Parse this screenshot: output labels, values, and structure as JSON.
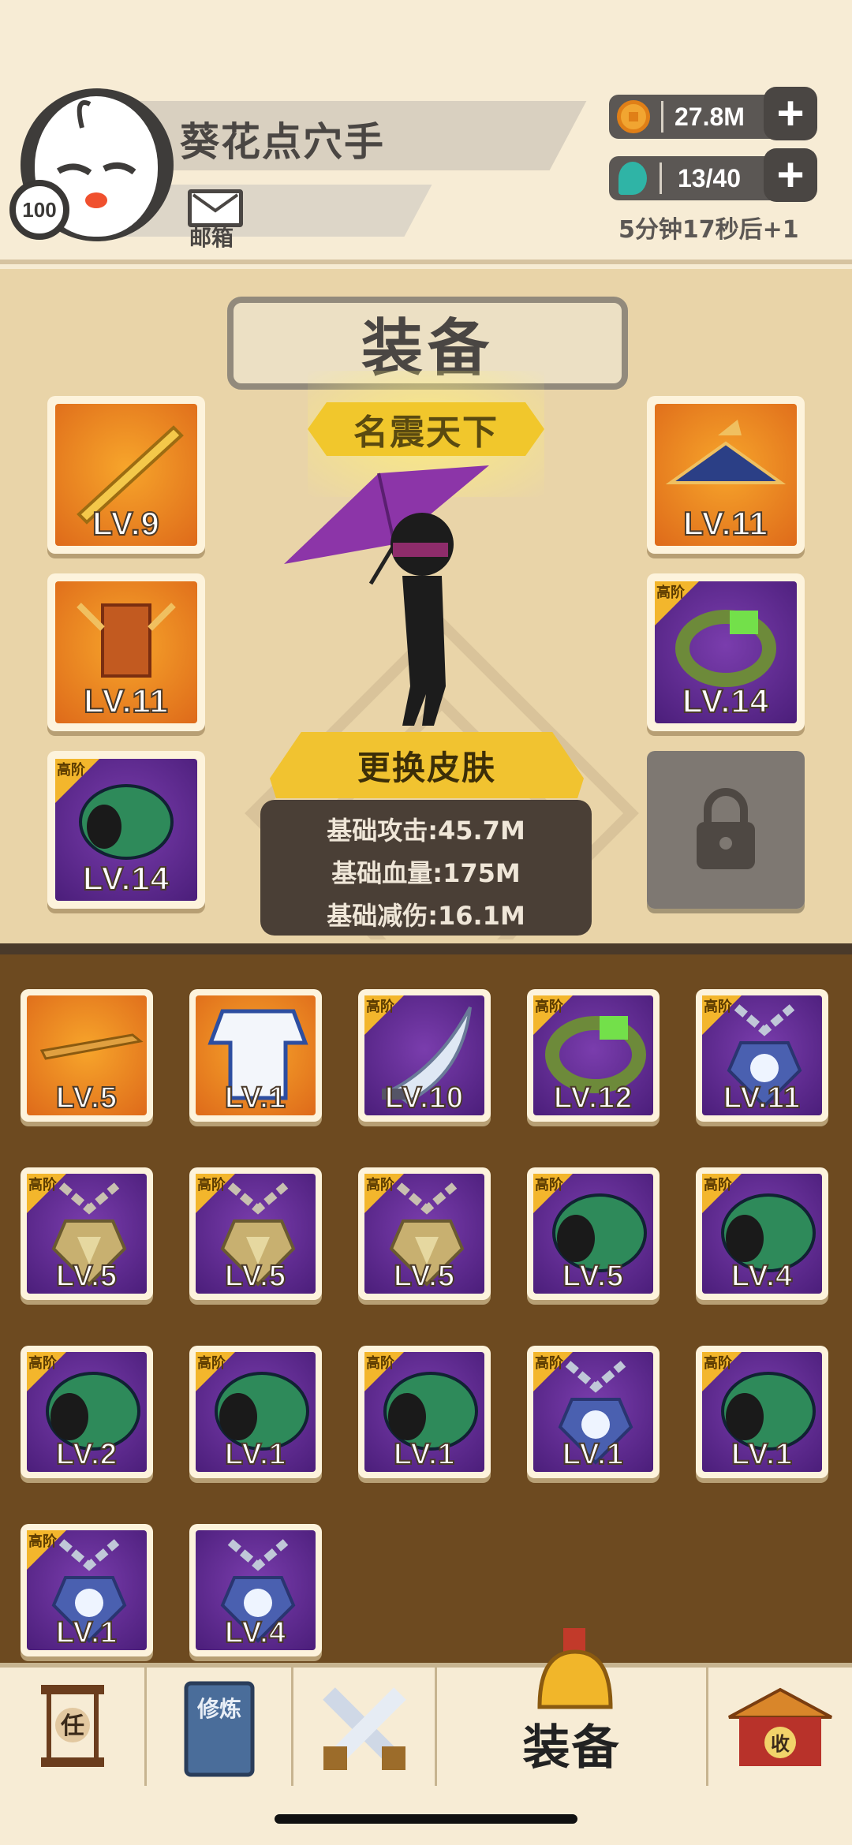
{
  "player": {
    "name": "葵花点穴手",
    "level": "100",
    "mail_label": "邮箱"
  },
  "resources": {
    "coins": "27.8M",
    "energy": "13/40",
    "regen_text": "5分钟17秒后+1"
  },
  "equipment": {
    "title": "装备",
    "rank_badge": "名震天下",
    "change_skin_label": "更换皮肤",
    "stats": [
      "基础攻击:45.7M",
      "基础血量:175M",
      "基础减伤:16.1M"
    ],
    "left_slots": [
      {
        "lv": "LV.9",
        "rarity": "orange",
        "item": "sword"
      },
      {
        "lv": "LV.11",
        "rarity": "orange",
        "item": "armor"
      },
      {
        "lv": "LV.14",
        "rarity": "purple",
        "item": "bracer",
        "tag": "高阶"
      }
    ],
    "right_slots": [
      {
        "lv": "LV.11",
        "rarity": "orange",
        "item": "hat"
      },
      {
        "lv": "LV.14",
        "rarity": "purple",
        "item": "ring",
        "tag": "高阶"
      },
      {
        "lv": "",
        "rarity": "gray",
        "item": "lock-icon"
      }
    ]
  },
  "inventory": [
    {
      "lv": "LV.5",
      "rarity": "orange",
      "item": "dart"
    },
    {
      "lv": "LV.1",
      "rarity": "orange",
      "item": "robe"
    },
    {
      "lv": "LV.10",
      "rarity": "purple",
      "item": "blade",
      "tag": "高阶"
    },
    {
      "lv": "LV.12",
      "rarity": "purple",
      "item": "ring",
      "tag": "高阶"
    },
    {
      "lv": "LV.11",
      "rarity": "purple",
      "item": "amulet-blue",
      "tag": "高阶"
    },
    {
      "lv": "LV.5",
      "rarity": "purple",
      "item": "amulet-gold",
      "tag": "高阶"
    },
    {
      "lv": "LV.5",
      "rarity": "purple",
      "item": "amulet-gold",
      "tag": "高阶"
    },
    {
      "lv": "LV.5",
      "rarity": "purple",
      "item": "amulet-gold",
      "tag": "高阶"
    },
    {
      "lv": "LV.5",
      "rarity": "purple",
      "item": "bracer",
      "tag": "高阶"
    },
    {
      "lv": "LV.4",
      "rarity": "purple",
      "item": "bracer",
      "tag": "高阶"
    },
    {
      "lv": "LV.2",
      "rarity": "purple",
      "item": "bracer",
      "tag": "高阶"
    },
    {
      "lv": "LV.1",
      "rarity": "purple",
      "item": "bracer",
      "tag": "高阶"
    },
    {
      "lv": "LV.1",
      "rarity": "purple",
      "item": "bracer",
      "tag": "高阶"
    },
    {
      "lv": "LV.1",
      "rarity": "purple",
      "item": "amulet-blue",
      "tag": "高阶"
    },
    {
      "lv": "LV.1",
      "rarity": "purple",
      "item": "bracer",
      "tag": "高阶"
    },
    {
      "lv": "LV.1",
      "rarity": "purple",
      "item": "amulet-blue",
      "tag": "高阶"
    },
    {
      "lv": "LV.4",
      "rarity": "purple",
      "item": "amulet-blue"
    }
  ],
  "nav": {
    "task_icon_char": "任",
    "train_icon_chars": "修炼",
    "equip_label": "装备",
    "collect_icon_char": "收"
  },
  "colors": {
    "orange_slot": "#de6a1a",
    "purple_slot": "#5b2a8a",
    "tag_gold": "#f3b62c",
    "inventory_bg": "#6d4a20"
  }
}
